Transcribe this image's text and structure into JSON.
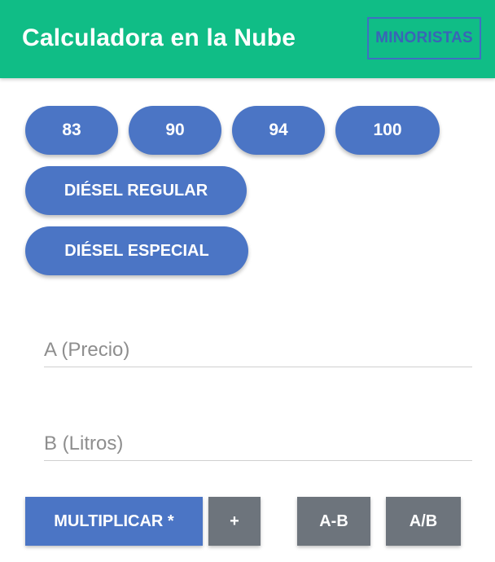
{
  "header": {
    "title": "Calculadora en la Nube",
    "retail_button": "MINORISTAS"
  },
  "fuel_buttons": [
    "83",
    "90",
    "94",
    "100"
  ],
  "diesel_buttons": [
    "DIÉSEL REGULAR",
    "DIÉSEL ESPECIAL"
  ],
  "inputs": {
    "a": {
      "placeholder": "A (Precio)",
      "value": ""
    },
    "b": {
      "placeholder": "B (Litros)",
      "value": ""
    }
  },
  "operations": {
    "multiply": "MULTIPLICAR *",
    "add": "+",
    "subtract": "A-B",
    "divide": "A/B"
  },
  "colors": {
    "appbar": "#10bd86",
    "primary": "#4b75c5",
    "secondary": "#6d747c"
  }
}
